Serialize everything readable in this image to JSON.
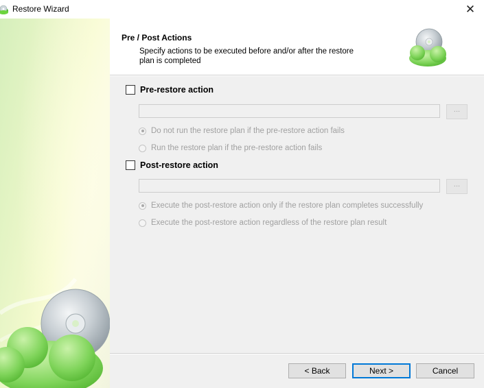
{
  "window": {
    "title": "Restore Wizard",
    "close_glyph": "✕"
  },
  "header": {
    "title": "Pre / Post Actions",
    "description": "Specify actions to be executed before and/or after the restore plan is completed",
    "icon": "cloud-disc-icon"
  },
  "pre_restore": {
    "label": "Pre-restore action",
    "checked": false,
    "command_value": "",
    "browse_label": "...",
    "options": [
      {
        "label": "Do not run the restore plan if the pre-restore action fails",
        "selected": true,
        "enabled": false
      },
      {
        "label": "Run the restore plan if the pre-restore action fails",
        "selected": false,
        "enabled": false
      }
    ]
  },
  "post_restore": {
    "label": "Post-restore action",
    "checked": false,
    "command_value": "",
    "browse_label": "...",
    "options": [
      {
        "label": "Execute the post-restore action only if the restore plan completes successfully",
        "selected": true,
        "enabled": false
      },
      {
        "label": "Execute the post-restore action regardless of the restore plan result",
        "selected": false,
        "enabled": false
      }
    ]
  },
  "buttons": {
    "back": "< Back",
    "next": "Next >",
    "cancel": "Cancel"
  },
  "colors": {
    "accent": "#0078d7",
    "disabled_text": "#a0a0a0",
    "brand_green": "#5cc23a"
  }
}
